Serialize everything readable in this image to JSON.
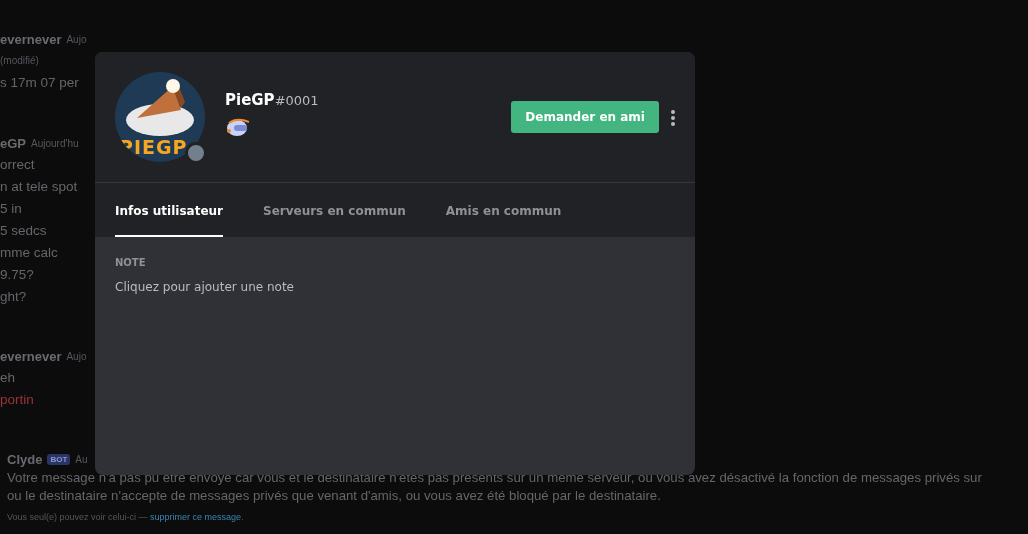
{
  "chat": {
    "messages": [
      {
        "author": "evernever",
        "timestamp": "Aujo",
        "lines": [
          {
            "kind": "edited",
            "text": "(modifié)"
          },
          {
            "kind": "plain",
            "text": "s 17m 07 per"
          }
        ]
      },
      {
        "author": "eGP",
        "timestamp": "Aujourd'hu",
        "lines": [
          {
            "kind": "plain",
            "text": "orrect"
          },
          {
            "kind": "plain",
            "text": "n at tele spot"
          },
          {
            "kind": "plain",
            "text": "5 in"
          },
          {
            "kind": "plain",
            "text": "5 sedcs"
          },
          {
            "kind": "plain",
            "text": "mme calc"
          },
          {
            "kind": "plain",
            "text": "9.75?"
          },
          {
            "kind": "plain",
            "text": "ght?"
          }
        ]
      },
      {
        "author": "evernever",
        "timestamp": "Aujo",
        "lines": [
          {
            "kind": "plain",
            "text": "eh"
          },
          {
            "kind": "highlight",
            "text": "portin"
          }
        ]
      },
      {
        "author": "Clyde",
        "badge": "BOT",
        "timestamp": "Au",
        "lines": [
          {
            "kind": "plain",
            "text": "Votre message n'a pas pu être envoyé car vous et le destinataire n'êtes pas présents sur un même serveur, ou vous avez désactivé la fonction de messages privés sur"
          },
          {
            "kind": "plain",
            "text": "ou le destinataire n'accepte de messages privés que venant d'amis, ou vous avez été bloqué par le destinataire."
          }
        ],
        "note": {
          "text": "Vous seul(e) pouvez voir celui-ci —",
          "link": "supprimer ce message",
          "end": "."
        }
      }
    ]
  },
  "profile": {
    "username": "PieGP",
    "discriminator": "#0001",
    "avatar_text": "PIEGP",
    "online": false,
    "action_button": "Demander en ami",
    "tabs": [
      {
        "label": "Infos utilisateur",
        "selected": true
      },
      {
        "label": "Serveurs en commun",
        "selected": false
      },
      {
        "label": "Amis en commun",
        "selected": false
      }
    ],
    "note": {
      "heading": "NOTE",
      "placeholder": "Cliquez pour ajouter une note"
    }
  }
}
